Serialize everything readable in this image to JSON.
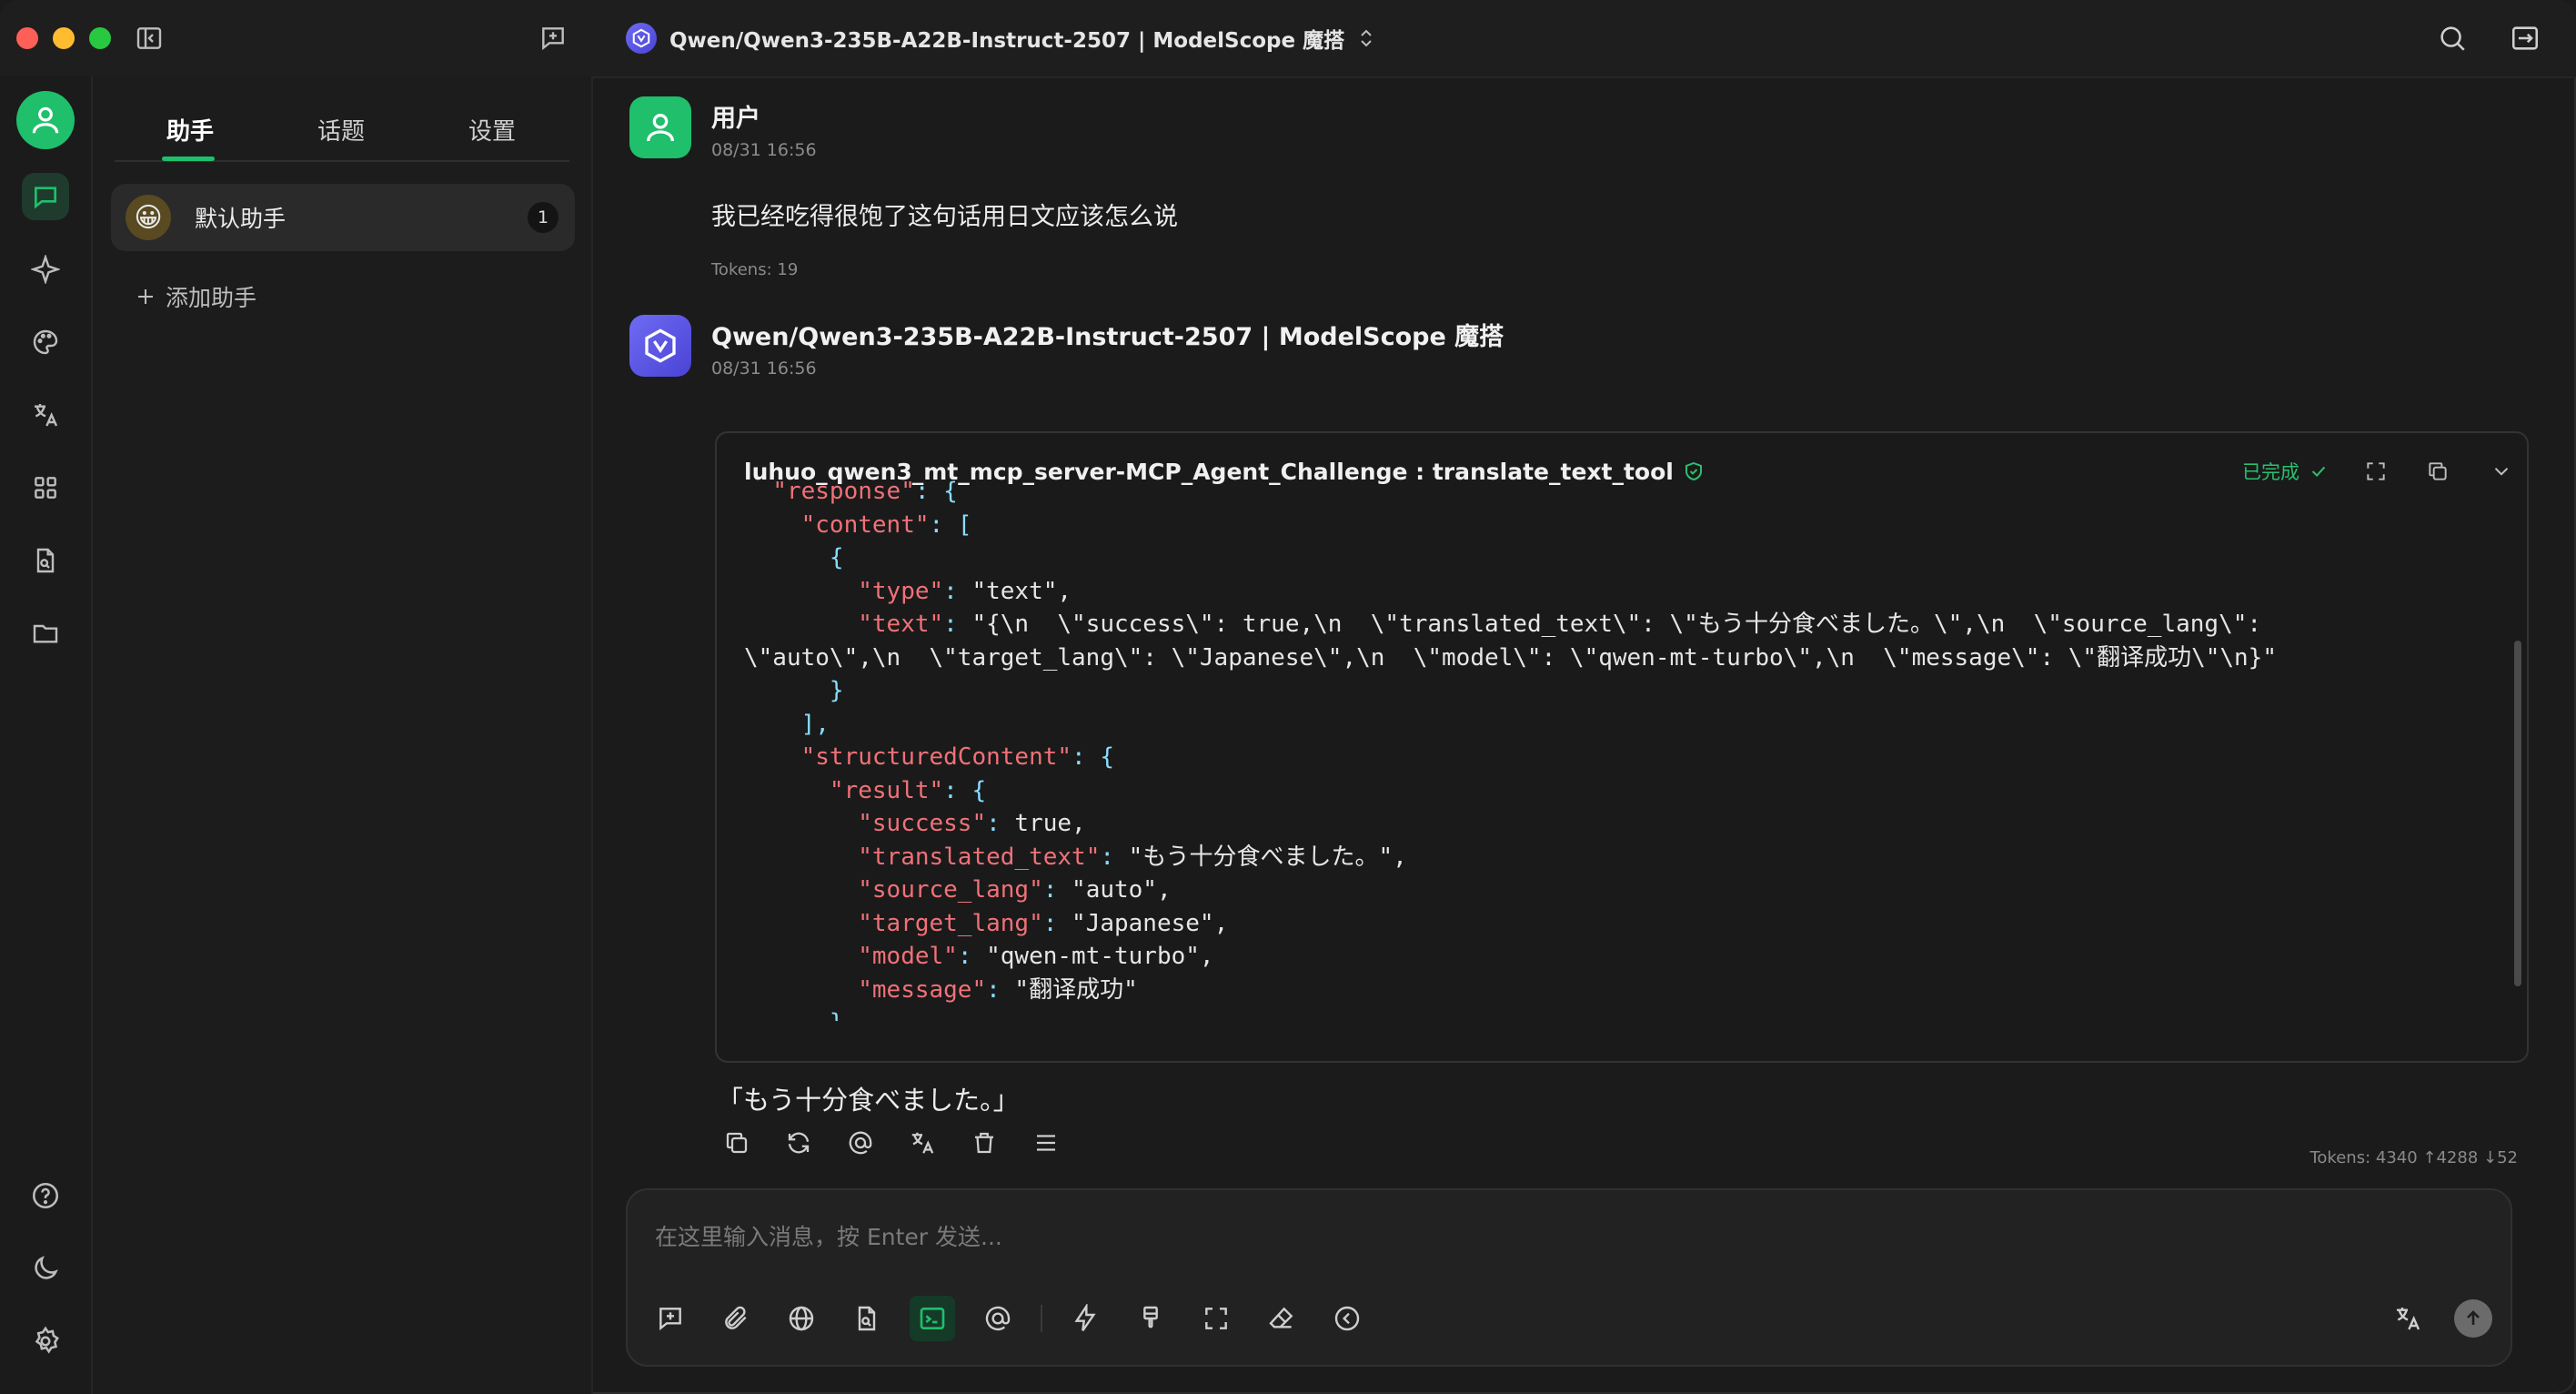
{
  "window": {
    "model_title": "Qwen/Qwen3-235B-A22B-Instruct-2507 | ModelScope 魔搭"
  },
  "sidebar": {
    "tabs": [
      {
        "label": "助手",
        "active": true
      },
      {
        "label": "话题",
        "active": false
      },
      {
        "label": "设置",
        "active": false
      }
    ],
    "assistant": {
      "name": "默认助手",
      "count": "1",
      "emoji": "😀"
    },
    "add_assistant": "添加助手"
  },
  "messages": [
    {
      "role": "user",
      "name": "用户",
      "time": "08/31 16:56",
      "text": "我已经吃得很饱了这句话用日文应该怎么说",
      "tokens": "Tokens: 19"
    },
    {
      "role": "assistant",
      "name": "Qwen/Qwen3-235B-A22B-Instruct-2507 | ModelScope 魔搭",
      "time": "08/31 16:56",
      "tool_call": {
        "title": "luhuo_qwen3_mt_mcp_server-MCP_Agent_Challenge : translate_text_tool",
        "status": "已完成",
        "code_lines": [
          "  \"response\": {",
          "    \"content\": [",
          "      {",
          "        \"type\": \"text\",",
          "        \"text\": \"{\\n  \\\"success\\\": true,\\n  \\\"translated_text\\\": \\\"もう十分食べました。\\\",\\n  \\\"source_lang\\\":",
          "\\\"auto\\\",\\n  \\\"target_lang\\\": \\\"Japanese\\\",\\n  \\\"model\\\": \\\"qwen-mt-turbo\\\",\\n  \\\"message\\\": \\\"翻译成功\\\"\\n}\"",
          "      }",
          "    ],",
          "    \"structuredContent\": {",
          "      \"result\": {",
          "        \"success\": true,",
          "        \"translated_text\": \"もう十分食べました。\",",
          "        \"source_lang\": \"auto\",",
          "        \"target_lang\": \"Japanese\",",
          "        \"model\": \"qwen-mt-turbo\",",
          "        \"message\": \"翻译成功\"",
          "      }",
          "    },"
        ]
      },
      "answer": "「もう十分食べました。」",
      "tokens": "Tokens: 4340 ↑4288 ↓52"
    }
  ],
  "input": {
    "placeholder": "在这里输入消息，按 Enter 发送..."
  },
  "colors": {
    "accent": "#1fbf6c",
    "background": "#1b1b1b",
    "json_key": "#f07178",
    "json_string": "#c3e88d",
    "json_punct": "#89ddff"
  }
}
